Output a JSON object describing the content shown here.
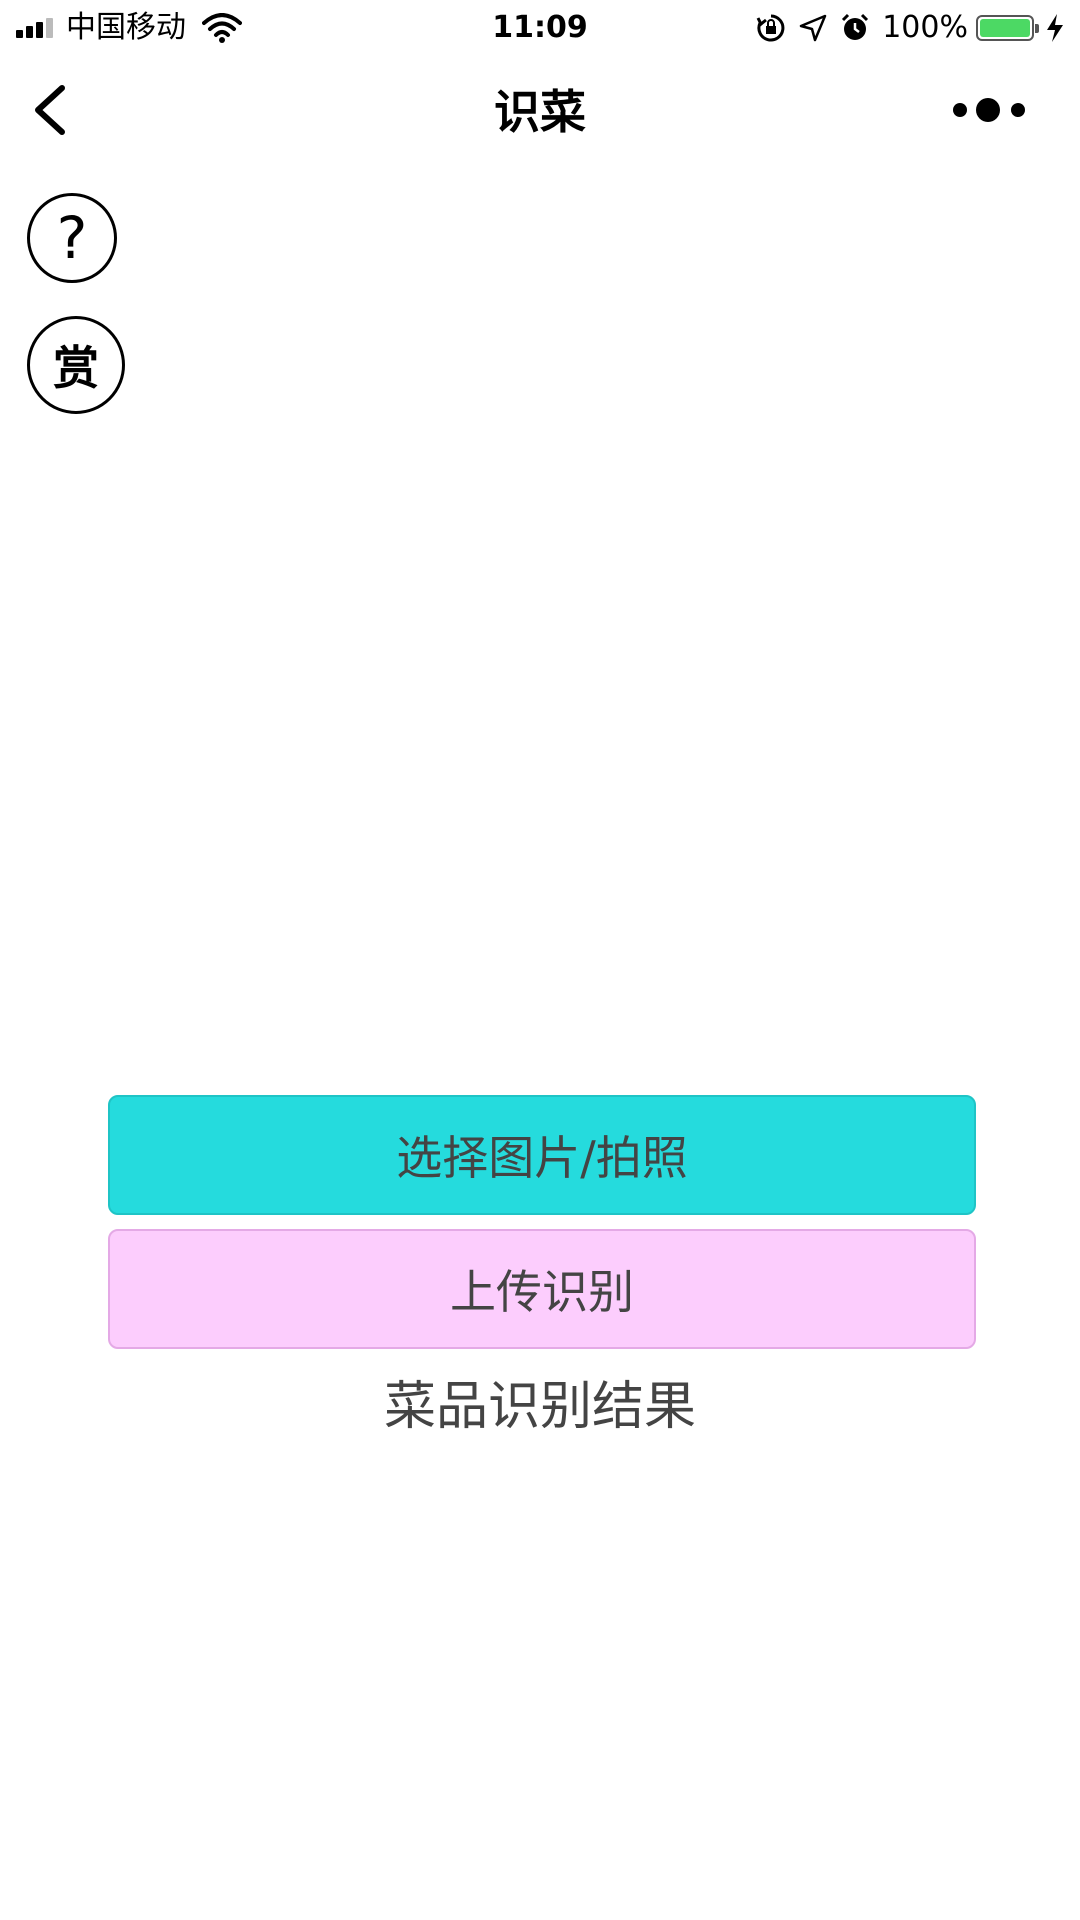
{
  "status_bar": {
    "carrier": "中国移动",
    "time": "11:09",
    "battery_percent": "100%",
    "battery_level": 1.0,
    "icons": [
      "signal-icon",
      "wifi-icon",
      "orientation-lock-icon",
      "location-arrow-icon",
      "alarm-icon",
      "battery-icon",
      "charging-bolt-icon"
    ]
  },
  "nav": {
    "title": "识菜",
    "back_icon": "chevron-left-icon",
    "more_icon": "more-dots-icon"
  },
  "side_buttons": {
    "help_label": "?",
    "reward_label": "赏"
  },
  "actions": {
    "choose_label": "选择图片/拍照",
    "upload_label": "上传识别",
    "choose_color": "#25dbdd",
    "upload_color": "#fccdfd"
  },
  "result": {
    "label": "菜品识别结果"
  }
}
